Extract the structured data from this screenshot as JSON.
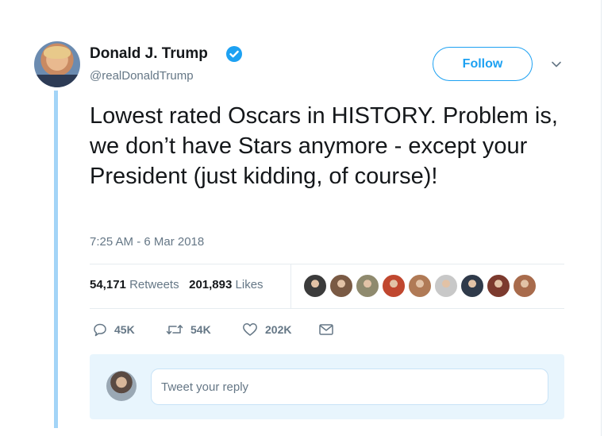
{
  "author": {
    "name": "Donald J. Trump",
    "handle": "@realDonaldTrump"
  },
  "follow_button": {
    "label": "Follow"
  },
  "tweet": {
    "text": "Lowest rated Oscars in HISTORY. Problem is, we don’t have Stars anymore - except your President (just kidding, of course)!",
    "timestamp": "7:25 AM - 6 Mar 2018"
  },
  "stats": {
    "retweets_count": "54,171",
    "retweets_label": "Retweets",
    "likes_count": "201,893",
    "likes_label": "Likes"
  },
  "liker_avatars": [
    {
      "color": "#3b3b3b"
    },
    {
      "color": "#7a5a44"
    },
    {
      "color": "#8f8a6e"
    },
    {
      "color": "#c0472f"
    },
    {
      "color": "#b07a56"
    },
    {
      "color": "#c8c8c8"
    },
    {
      "color": "#2f3a4a"
    },
    {
      "color": "#7c3a2e"
    },
    {
      "color": "#a86b4c"
    }
  ],
  "actions": {
    "reply_count": "45K",
    "retweet_count": "54K",
    "like_count": "202K"
  },
  "reply": {
    "placeholder": "Tweet your reply"
  },
  "colors": {
    "accent": "#1da1f2",
    "thread_line": "#a3d4f7",
    "muted": "#657786",
    "reply_bg": "#e8f5fd"
  }
}
